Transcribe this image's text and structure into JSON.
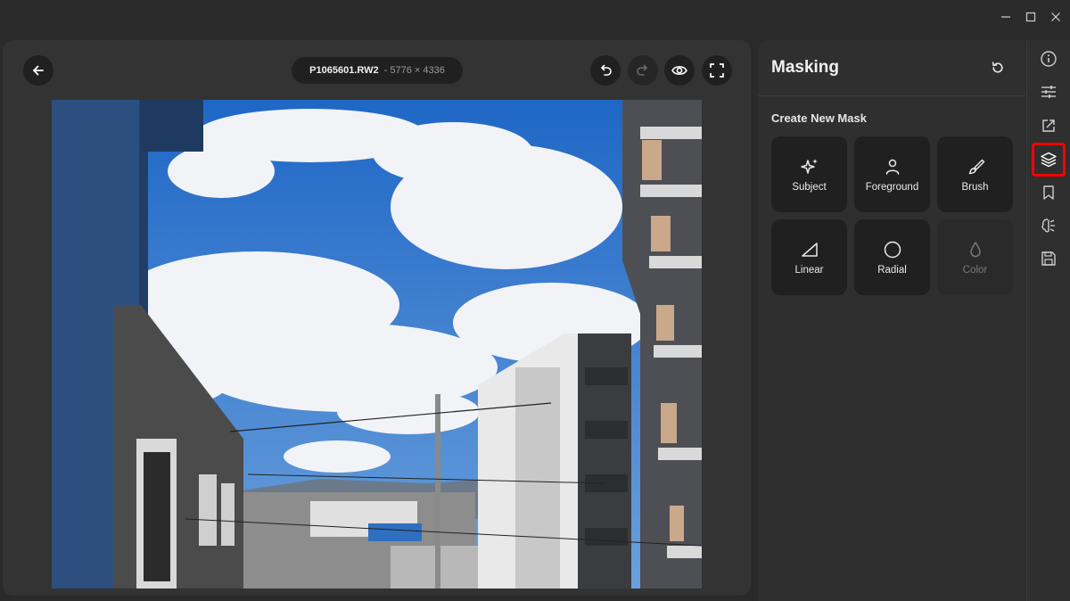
{
  "window": {
    "controls": [
      "minimize-icon",
      "maximize-icon",
      "close-icon"
    ]
  },
  "viewer": {
    "file_name": "P1065601.RW2",
    "dimensions": "- 5776 × 4336",
    "buttons": [
      "back-arrow-icon",
      "undo-icon",
      "redo-icon",
      "eye-icon",
      "fullscreen-icon"
    ]
  },
  "masking": {
    "title": "Masking",
    "section_title": "Create New Mask",
    "tools": [
      {
        "label": "Subject",
        "icon": "sparkles-icon",
        "enabled": true
      },
      {
        "label": "Foreground",
        "icon": "person-icon",
        "enabled": true
      },
      {
        "label": "Brush",
        "icon": "brush-icon",
        "enabled": true
      },
      {
        "label": "Linear",
        "icon": "linear-gradient-icon",
        "enabled": true
      },
      {
        "label": "Radial",
        "icon": "circle-icon",
        "enabled": true
      },
      {
        "label": "Color",
        "icon": "droplet-icon",
        "enabled": false
      }
    ]
  },
  "rail": {
    "items": [
      "info-icon",
      "sliders-icon",
      "export-icon",
      "layers-icon",
      "bookmark-icon",
      "ai-brain-icon",
      "save-icon"
    ],
    "active": "layers-icon",
    "highlight_color": "#ff0000"
  },
  "colors": {
    "background": "#2a2a2a",
    "panel": "#2f2f2f",
    "button": "#202020"
  }
}
